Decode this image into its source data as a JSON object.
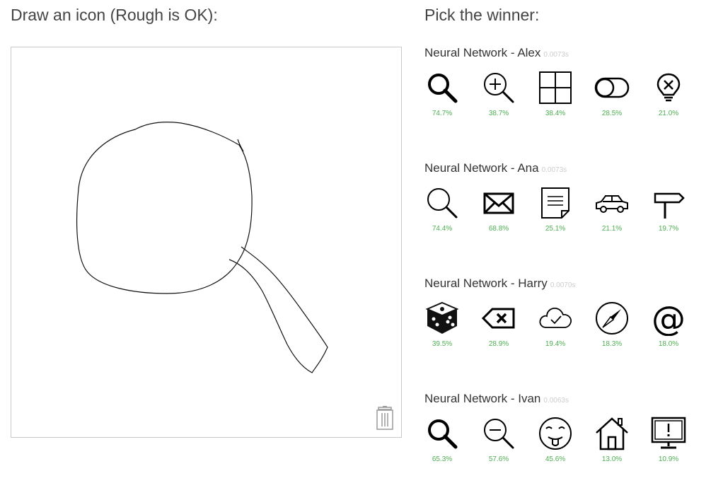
{
  "left_heading": "Draw an icon (Rough is OK):",
  "right_heading": "Pick the winner:",
  "networks": [
    {
      "name": "Neural Network - Alex",
      "time": "0.0073s",
      "candidates": [
        {
          "icon": "search-icon",
          "score": "74.7%"
        },
        {
          "icon": "zoom-in-icon",
          "score": "38.7%"
        },
        {
          "icon": "grid-icon",
          "score": "38.4%"
        },
        {
          "icon": "toggle-icon",
          "score": "28.5%"
        },
        {
          "icon": "lightbulb-x-icon",
          "score": "21.0%"
        }
      ]
    },
    {
      "name": "Neural Network - Ana",
      "time": "0.0073s",
      "candidates": [
        {
          "icon": "search-outline-icon",
          "score": "74.4%"
        },
        {
          "icon": "envelope-icon",
          "score": "68.8%"
        },
        {
          "icon": "note-icon",
          "score": "25.1%"
        },
        {
          "icon": "car-icon",
          "score": "21.1%"
        },
        {
          "icon": "signpost-icon",
          "score": "19.7%"
        }
      ]
    },
    {
      "name": "Neural Network - Harry",
      "time": "0.0070s",
      "candidates": [
        {
          "icon": "dice-icon",
          "score": "39.5%"
        },
        {
          "icon": "backspace-icon",
          "score": "28.9%"
        },
        {
          "icon": "cloud-check-icon",
          "score": "19.4%"
        },
        {
          "icon": "compass-icon",
          "score": "18.3%"
        },
        {
          "icon": "at-sign-icon",
          "score": "18.0%"
        }
      ]
    },
    {
      "name": "Neural Network - Ivan",
      "time": "0.0063s",
      "candidates": [
        {
          "icon": "search-icon",
          "score": "65.3%"
        },
        {
          "icon": "zoom-out-icon",
          "score": "57.6%"
        },
        {
          "icon": "tongue-face-icon",
          "score": "45.6%"
        },
        {
          "icon": "house-icon",
          "score": "13.0%"
        },
        {
          "icon": "monitor-alert-icon",
          "score": "10.9%"
        }
      ]
    }
  ]
}
